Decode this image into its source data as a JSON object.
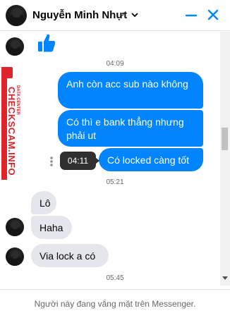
{
  "header": {
    "name": "Nguyễn Minh Nhựt",
    "icons": [
      "avatar",
      "chevron-down-icon",
      "minimize-icon",
      "close-icon"
    ]
  },
  "watermark": {
    "main": "CHECKSCAM.INFO",
    "sub": "DATA CENTER"
  },
  "messages": {
    "ts1": "04:09",
    "out1": "Anh còn acc sub nào không",
    "out2": "Có thì e bank thẳng nhưng phải ut",
    "out3": "Có locked càng tốt",
    "tooltip": "04:11",
    "ts2": "05:21",
    "in1": "Lô",
    "in2": "Haha",
    "in3": "Via lock a có",
    "ts3": "05:45"
  },
  "footer": {
    "status": "Người này đang vắng mặt trên Messenger."
  },
  "colors": {
    "accent": "#0084ff",
    "incoming": "#e4e6eb",
    "watermark": "#e0242b"
  }
}
